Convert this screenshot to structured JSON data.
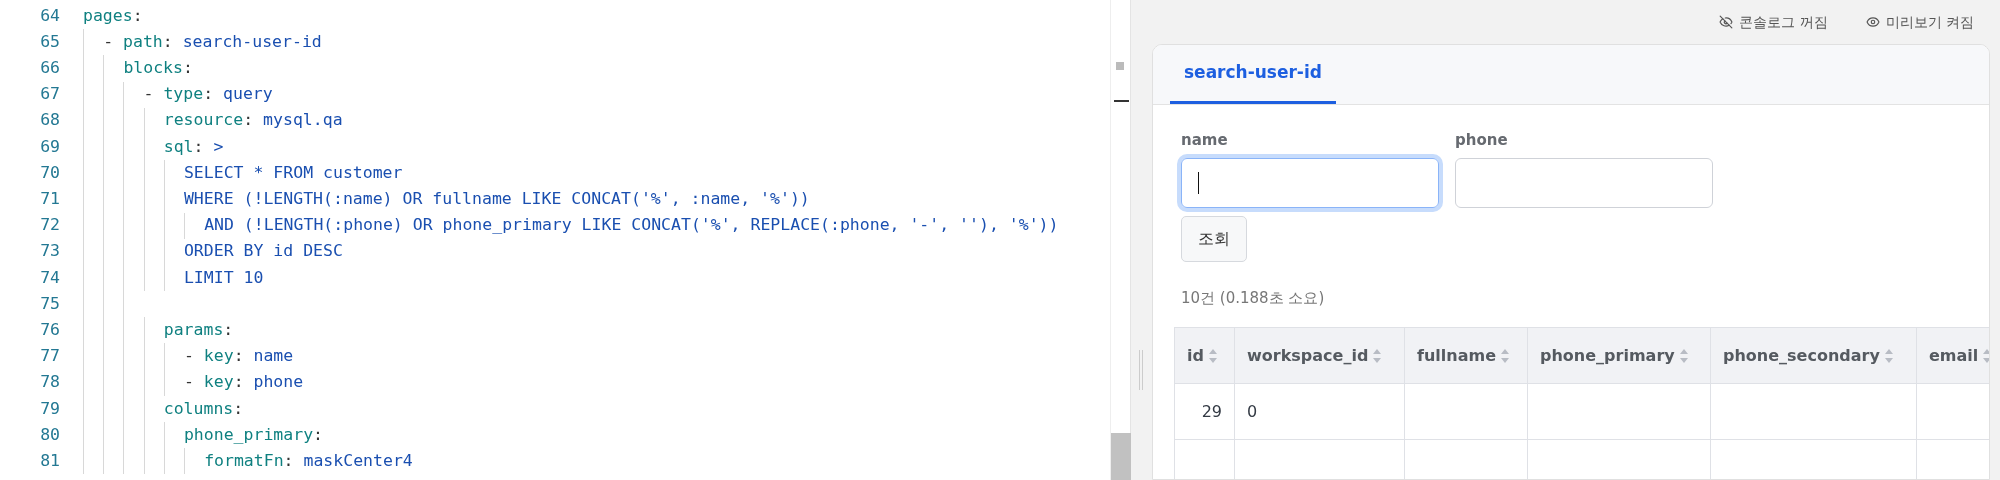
{
  "editor": {
    "lines": [
      {
        "number": "64",
        "tokens": [
          {
            "kind": "key",
            "text": "pages"
          },
          {
            "kind": "punct",
            "text": ":"
          }
        ],
        "children": [
          {
            "number": "65",
            "tokens": [
              {
                "kind": "punct",
                "text": "- "
              },
              {
                "kind": "key",
                "text": "path"
              },
              {
                "kind": "punct",
                "text": ": "
              },
              {
                "kind": "value",
                "text": "search-user-id"
              }
            ],
            "children": [
              {
                "number": "66",
                "tokens": [
                  {
                    "kind": "key",
                    "text": "blocks"
                  },
                  {
                    "kind": "punct",
                    "text": ":"
                  }
                ],
                "children": [
                  {
                    "number": "67",
                    "tokens": [
                      {
                        "kind": "punct",
                        "text": "- "
                      },
                      {
                        "kind": "key",
                        "text": "type"
                      },
                      {
                        "kind": "punct",
                        "text": ": "
                      },
                      {
                        "kind": "value",
                        "text": "query"
                      }
                    ],
                    "children": [
                      {
                        "number": "68",
                        "tokens": [
                          {
                            "kind": "key",
                            "text": "resource"
                          },
                          {
                            "kind": "punct",
                            "text": ": "
                          },
                          {
                            "kind": "value",
                            "text": "mysql.qa"
                          }
                        ]
                      },
                      {
                        "number": "69",
                        "tokens": [
                          {
                            "kind": "key",
                            "text": "sql"
                          },
                          {
                            "kind": "punct",
                            "text": ": "
                          },
                          {
                            "kind": "value",
                            "text": ">"
                          }
                        ],
                        "children": [
                          {
                            "number": "70",
                            "tokens": [
                              {
                                "kind": "value",
                                "text": "SELECT * FROM customer"
                              }
                            ]
                          },
                          {
                            "number": "71",
                            "tokens": [
                              {
                                "kind": "value",
                                "text": "WHERE (!LENGTH(:name) OR fullname LIKE CONCAT('%', :name, '%'))"
                              }
                            ],
                            "children": [
                              {
                                "number": "72",
                                "tokens": [
                                  {
                                    "kind": "value",
                                    "text": "AND (!LENGTH(:phone) OR phone_primary LIKE CONCAT('%', REPLACE(:phone, '-', ''), '%'))"
                                  }
                                ]
                              }
                            ]
                          },
                          {
                            "number": "73",
                            "tokens": [
                              {
                                "kind": "value",
                                "text": "ORDER BY id DESC"
                              }
                            ]
                          },
                          {
                            "number": "74",
                            "tokens": [
                              {
                                "kind": "value",
                                "text": "LIMIT 10"
                              }
                            ]
                          }
                        ]
                      },
                      {
                        "number": "75"
                      },
                      {
                        "number": "76",
                        "tokens": [
                          {
                            "kind": "key",
                            "text": "params"
                          },
                          {
                            "kind": "punct",
                            "text": ":"
                          }
                        ],
                        "children": [
                          {
                            "number": "77",
                            "tokens": [
                              {
                                "kind": "punct",
                                "text": "- "
                              },
                              {
                                "kind": "key",
                                "text": "key"
                              },
                              {
                                "kind": "punct",
                                "text": ": "
                              },
                              {
                                "kind": "value",
                                "text": "name"
                              }
                            ]
                          },
                          {
                            "number": "78",
                            "tokens": [
                              {
                                "kind": "punct",
                                "text": "- "
                              },
                              {
                                "kind": "key",
                                "text": "key"
                              },
                              {
                                "kind": "punct",
                                "text": ": "
                              },
                              {
                                "kind": "value",
                                "text": "phone"
                              }
                            ]
                          }
                        ]
                      },
                      {
                        "number": "79",
                        "tokens": [
                          {
                            "kind": "key",
                            "text": "columns"
                          },
                          {
                            "kind": "punct",
                            "text": ":"
                          }
                        ],
                        "children": [
                          {
                            "number": "80",
                            "tokens": [
                              {
                                "kind": "key",
                                "text": "phone_primary"
                              },
                              {
                                "kind": "punct",
                                "text": ":"
                              }
                            ],
                            "children": [
                              {
                                "number": "81",
                                "tokens": [
                                  {
                                    "kind": "key",
                                    "text": "formatFn"
                                  },
                                  {
                                    "kind": "punct",
                                    "text": ": "
                                  },
                                  {
                                    "kind": "value",
                                    "text": "maskCenter4"
                                  }
                                ]
                              }
                            ]
                          }
                        ]
                      }
                    ]
                  }
                ]
              }
            ]
          }
        ]
      }
    ]
  },
  "preview": {
    "toggles": [
      {
        "label": "콘솔로그 꺼짐",
        "on": false
      },
      {
        "label": "미리보기 켜짐",
        "on": true
      }
    ],
    "tabs": [
      {
        "label": "search-user-id",
        "selected": true
      }
    ],
    "fields": [
      {
        "label": "name",
        "focused": true
      },
      {
        "label": "phone",
        "focused": false
      }
    ],
    "submit": "조회",
    "result_summary": "10건 (0.188초 소요)",
    "table": {
      "columns": [
        "id",
        "workspace_id",
        "fullname",
        "phone_primary",
        "phone_secondary",
        "email"
      ],
      "rows": [
        {
          "cells": [
            "29",
            "0"
          ]
        }
      ]
    }
  }
}
